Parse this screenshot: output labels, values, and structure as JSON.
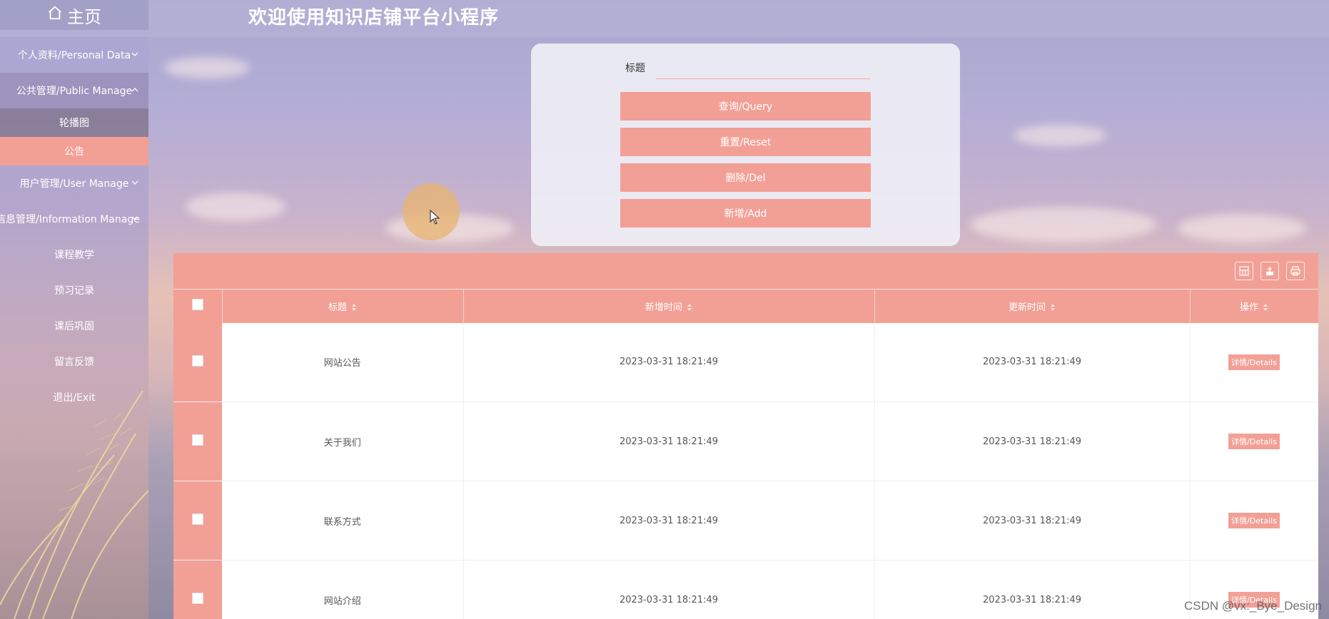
{
  "header": {
    "home_label": "主页",
    "site_title": "欢迎使用知识店铺平台小程序"
  },
  "sidebar": {
    "groups": [
      {
        "label": "个人资料/Personal Data"
      },
      {
        "label": "公共管理/Public Manage",
        "children": [
          {
            "label": "轮播图"
          },
          {
            "label": "公告"
          }
        ]
      },
      {
        "label": "用户管理/User Manage"
      },
      {
        "label": "信息管理/Information Manage"
      }
    ],
    "items": [
      {
        "label": "课程教学"
      },
      {
        "label": "预习记录"
      },
      {
        "label": "课后巩固"
      },
      {
        "label": "留言反馈"
      },
      {
        "label": "退出/Exit"
      }
    ]
  },
  "search": {
    "label": "标题",
    "value": "",
    "buttons": {
      "query": "查询/Query",
      "reset": "重置/Reset",
      "delete": "删除/Del",
      "add": "新增/Add"
    }
  },
  "table": {
    "columns": [
      "标题",
      "新增时间",
      "更新时间",
      "操作"
    ],
    "action_label": "详情/Details",
    "rows": [
      {
        "title": "网站公告",
        "created": "2023-03-31 18:21:49",
        "updated": "2023-03-31 18:21:49"
      },
      {
        "title": "关于我们",
        "created": "2023-03-31 18:21:49",
        "updated": "2023-03-31 18:21:49"
      },
      {
        "title": "联系方式",
        "created": "2023-03-31 18:21:49",
        "updated": "2023-03-31 18:21:49"
      },
      {
        "title": "网站介绍",
        "created": "2023-03-31 18:21:49",
        "updated": "2023-03-31 18:21:49"
      }
    ]
  },
  "watermark": "CSDN @vx:_Bye_Design",
  "colors": {
    "accent": "#f2a096",
    "panel": "#f0f0f6"
  }
}
